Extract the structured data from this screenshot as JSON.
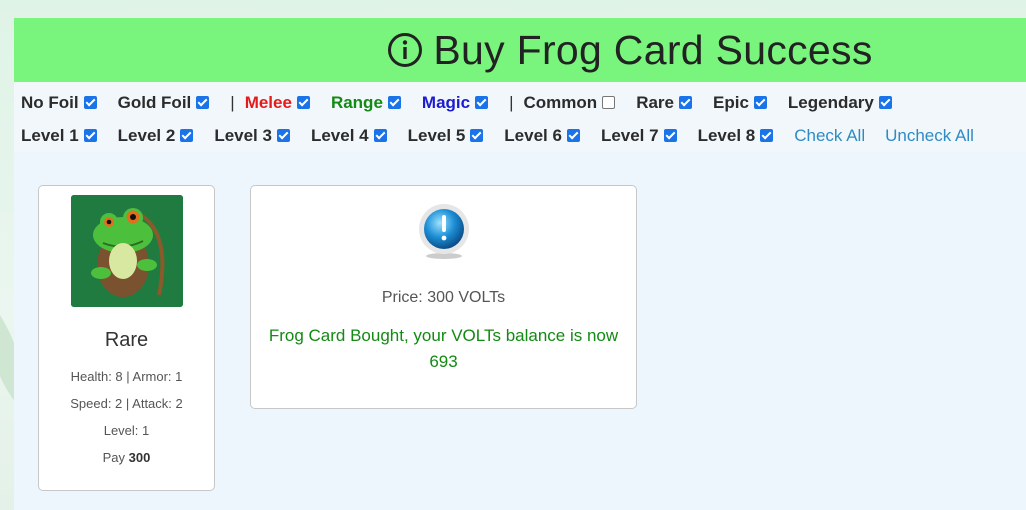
{
  "header": {
    "title": "Buy Frog Card Success",
    "icon": "info-circle-icon"
  },
  "filters": {
    "no_foil": "No Foil",
    "gold_foil": "Gold Foil",
    "separator": "|",
    "melee": "Melee",
    "range": "Range",
    "magic": "Magic",
    "common": "Common",
    "rare": "Rare",
    "epic": "Epic",
    "legendary": "Legendary",
    "levels": [
      "Level 1",
      "Level 2",
      "Level 3",
      "Level 4",
      "Level 5",
      "Level 6",
      "Level 7",
      "Level 8"
    ],
    "check_all": "Check All",
    "uncheck_all": "Uncheck All",
    "checked": {
      "no_foil": true,
      "gold_foil": true,
      "melee": true,
      "range": true,
      "magic": true,
      "common": false,
      "rare": true,
      "epic": true,
      "legendary": true,
      "levels": [
        true,
        true,
        true,
        true,
        true,
        true,
        true,
        true
      ]
    }
  },
  "card": {
    "rarity": "Rare",
    "health_armor": "Health: 8 | Armor: 1",
    "speed_attack": "Speed: 2 | Attack: 2",
    "level": "Level: 1",
    "pay_label": "Pay",
    "pay_value": "300",
    "image": "frog-archer-image"
  },
  "message": {
    "price": "Price: 300 VOLTs",
    "result": "Frog Card Bought, your VOLTs balance is now 693",
    "icon": "exclamation-icon"
  },
  "colors": {
    "header_bg": "#79f57e",
    "melee": "#e51b1b",
    "range": "#138a13",
    "magic": "#1b1bd1",
    "success": "#138a13",
    "link": "#2f8bc4"
  }
}
